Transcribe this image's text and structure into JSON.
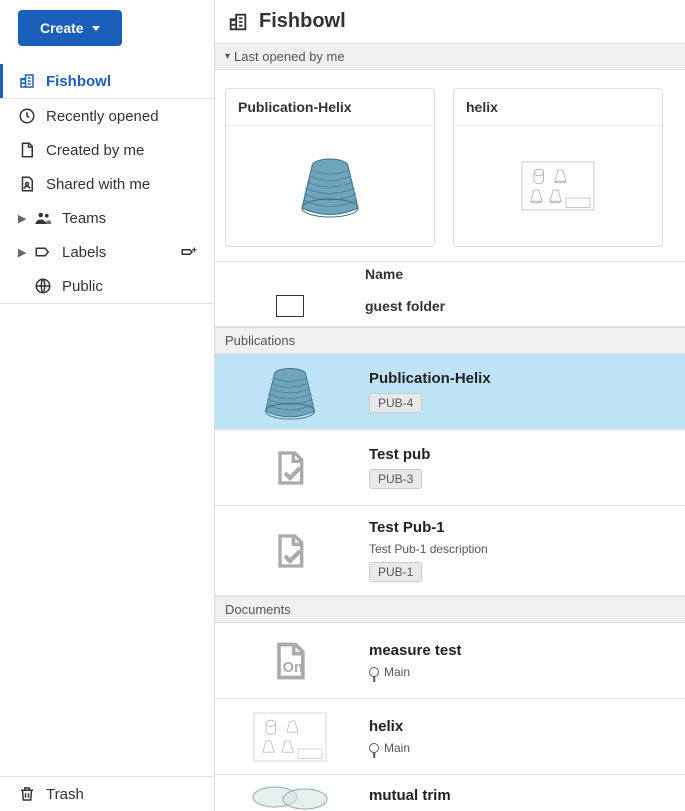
{
  "create_label": "Create",
  "page_title": "Fishbowl",
  "nav": {
    "fishbowl": "Fishbowl",
    "recently_opened": "Recently opened",
    "created_by_me": "Created by me",
    "shared_with_me": "Shared with me",
    "teams": "Teams",
    "labels": "Labels",
    "public": "Public",
    "trash": "Trash"
  },
  "sections": {
    "last_opened": "Last opened by me",
    "publications": "Publications",
    "documents": "Documents"
  },
  "cards": [
    {
      "title": "Publication-Helix"
    },
    {
      "title": "helix"
    }
  ],
  "list_header_name": "Name",
  "folder_row_name": "guest folder",
  "publications": [
    {
      "title": "Publication-Helix",
      "badge": "PUB-4",
      "selected": true
    },
    {
      "title": "Test pub",
      "badge": "PUB-3",
      "selected": false
    },
    {
      "title": "Test Pub-1",
      "desc": "Test Pub-1 description",
      "badge": "PUB-1",
      "selected": false
    }
  ],
  "documents": [
    {
      "title": "measure test",
      "branch": "Main"
    },
    {
      "title": "helix",
      "branch": "Main"
    },
    {
      "title": "mutual trim"
    }
  ]
}
